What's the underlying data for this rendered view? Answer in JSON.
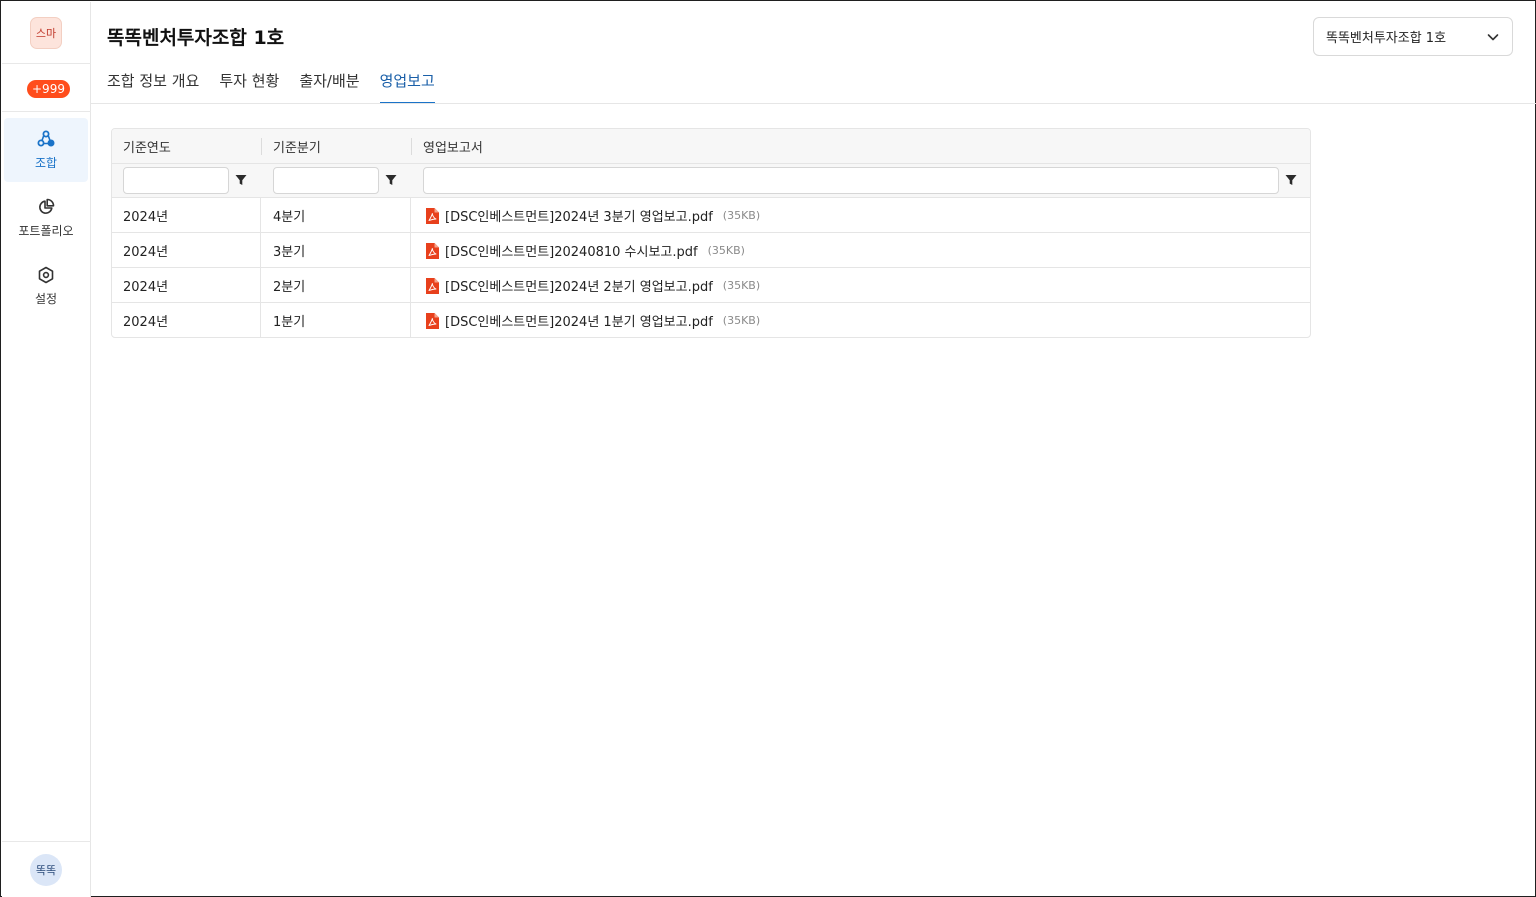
{
  "sidebar": {
    "avatar_top": "스마",
    "notification_count": "+999",
    "items": [
      {
        "label": "조합",
        "icon": "fund-icon",
        "active": true
      },
      {
        "label": "포트폴리오",
        "icon": "pie-chart-icon",
        "active": false
      },
      {
        "label": "설정",
        "icon": "gear-icon",
        "active": false
      }
    ],
    "avatar_bottom": "똑똑"
  },
  "header": {
    "title": "똑똑벤처투자조합 1호",
    "fund_select": {
      "selected": "똑똑벤처투자조합 1호"
    }
  },
  "tabs": [
    {
      "label": "조합 정보 개요",
      "active": false
    },
    {
      "label": "투자 현황",
      "active": false
    },
    {
      "label": "출자/배분",
      "active": false
    },
    {
      "label": "영업보고",
      "active": true
    }
  ],
  "grid": {
    "columns": [
      {
        "label": "기준연도"
      },
      {
        "label": "기준분기"
      },
      {
        "label": "영업보고서"
      }
    ],
    "filters": {
      "year": "",
      "quarter": "",
      "report": ""
    },
    "rows": [
      {
        "year": "2024년",
        "quarter": "4분기",
        "file": "[DSC인베스트먼트]2024년 3분기 영업보고.pdf",
        "size": "(35KB)"
      },
      {
        "year": "2024년",
        "quarter": "3분기",
        "file": "[DSC인베스트먼트]20240810 수시보고.pdf",
        "size": "(35KB)"
      },
      {
        "year": "2024년",
        "quarter": "2분기",
        "file": "[DSC인베스트먼트]2024년 2분기 영업보고.pdf",
        "size": "(35KB)"
      },
      {
        "year": "2024년",
        "quarter": "1분기",
        "file": "[DSC인베스트먼트]2024년 1분기 영업보고.pdf",
        "size": "(35KB)"
      }
    ]
  },
  "colors": {
    "accent": "#1a73c8",
    "badge": "#ff4d1c",
    "pdf": "#e8401c"
  }
}
